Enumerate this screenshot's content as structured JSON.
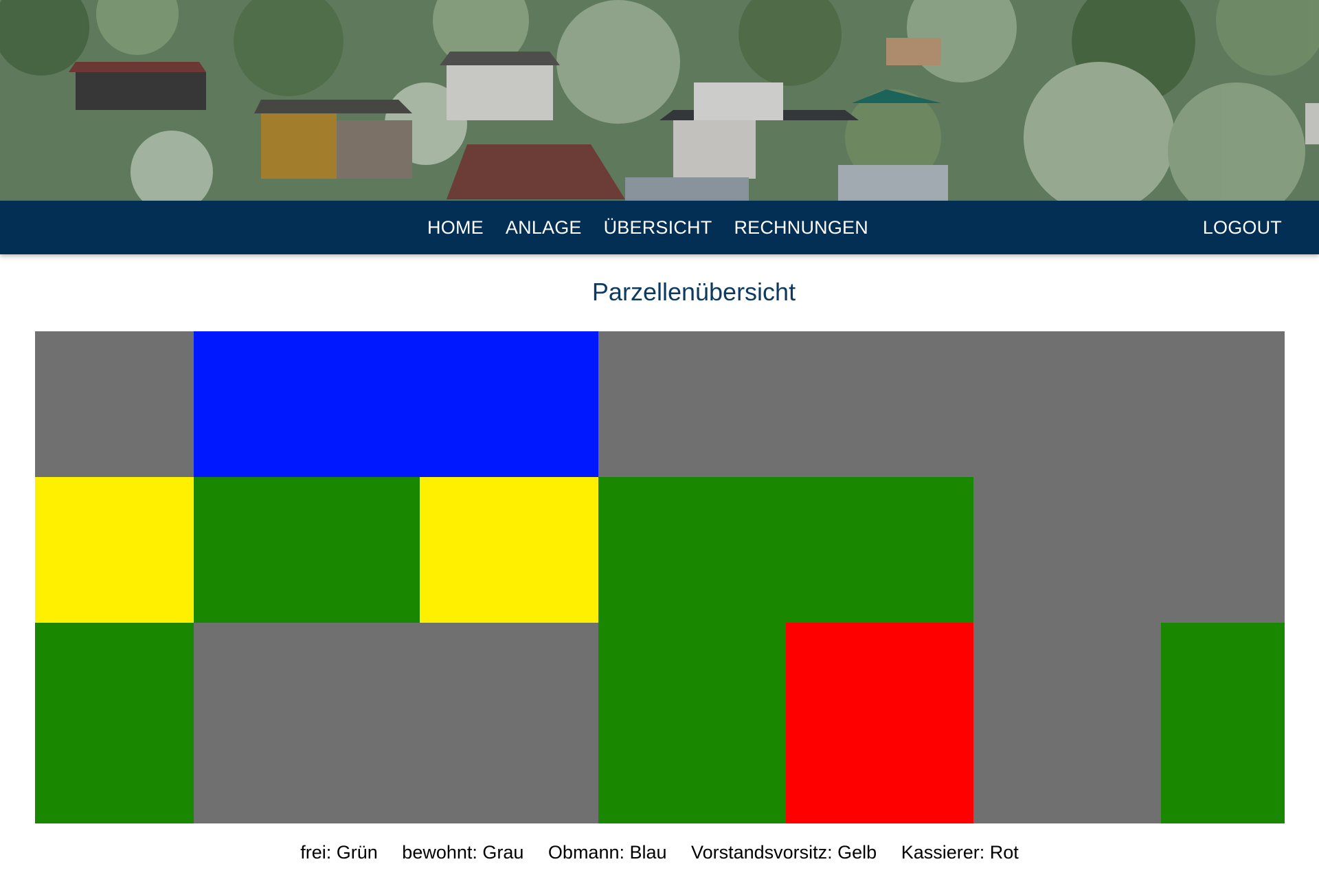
{
  "nav": {
    "links": [
      "HOME",
      "ANLAGE",
      "ÜBERSICHT",
      "RECHNUNGEN"
    ],
    "logout": "LOGOUT"
  },
  "page": {
    "title": "Parzellenübersicht"
  },
  "colors": {
    "nav_bg": "#042f54",
    "title": "#0d3a5e",
    "frei": "#1a8700",
    "bewohnt": "#707070",
    "obmann": "#0018ff",
    "vorstandsvorsitz": "#fff000",
    "kassierer": "#ff0000"
  },
  "parcels": {
    "rows": [
      [
        "bewohnt",
        "obmann",
        "obmann",
        "bewohnt",
        "bewohnt",
        "bewohnt",
        "bewohnt",
        "bewohnt"
      ],
      [
        "vorstandsvorsitz",
        "frei",
        "vorstandsvorsitz",
        "frei",
        "frei",
        "bewohnt",
        "bewohnt",
        "bewohnt"
      ],
      [
        "frei",
        "bewohnt",
        "bewohnt",
        "frei",
        "kassierer",
        "bewohnt",
        "frei",
        "frei"
      ]
    ]
  },
  "legend": {
    "items": [
      "frei: Grün",
      "bewohnt: Grau",
      "Obmann: Blau",
      "Vorstandsvorsitz: Gelb",
      "Kassierer: Rot"
    ]
  }
}
